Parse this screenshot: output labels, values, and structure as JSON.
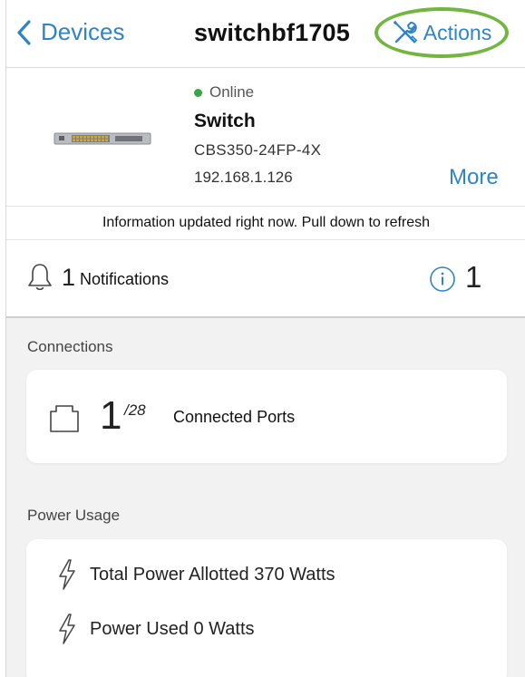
{
  "header": {
    "back_label": "Devices",
    "title": "switchbf1705",
    "actions_label": "Actions"
  },
  "device": {
    "status": "Online",
    "status_color": "#3aa544",
    "type": "Switch",
    "model": "CBS350-24FP-4X",
    "ip": "192.168.1.126",
    "more_label": "More"
  },
  "info_message": "Information updated right now. Pull down to refresh",
  "notifications": {
    "count": "1",
    "label": "Notifications",
    "info_count": "1"
  },
  "connections": {
    "section_title": "Connections",
    "connected": "1",
    "total": "/28",
    "label": "Connected Ports"
  },
  "power": {
    "section_title": "Power Usage",
    "allotted": "Total Power Allotted 370 Watts",
    "used": "Power Used 0 Watts"
  },
  "colors": {
    "accent": "#2f84c6",
    "highlight_ring": "#72b63f"
  }
}
